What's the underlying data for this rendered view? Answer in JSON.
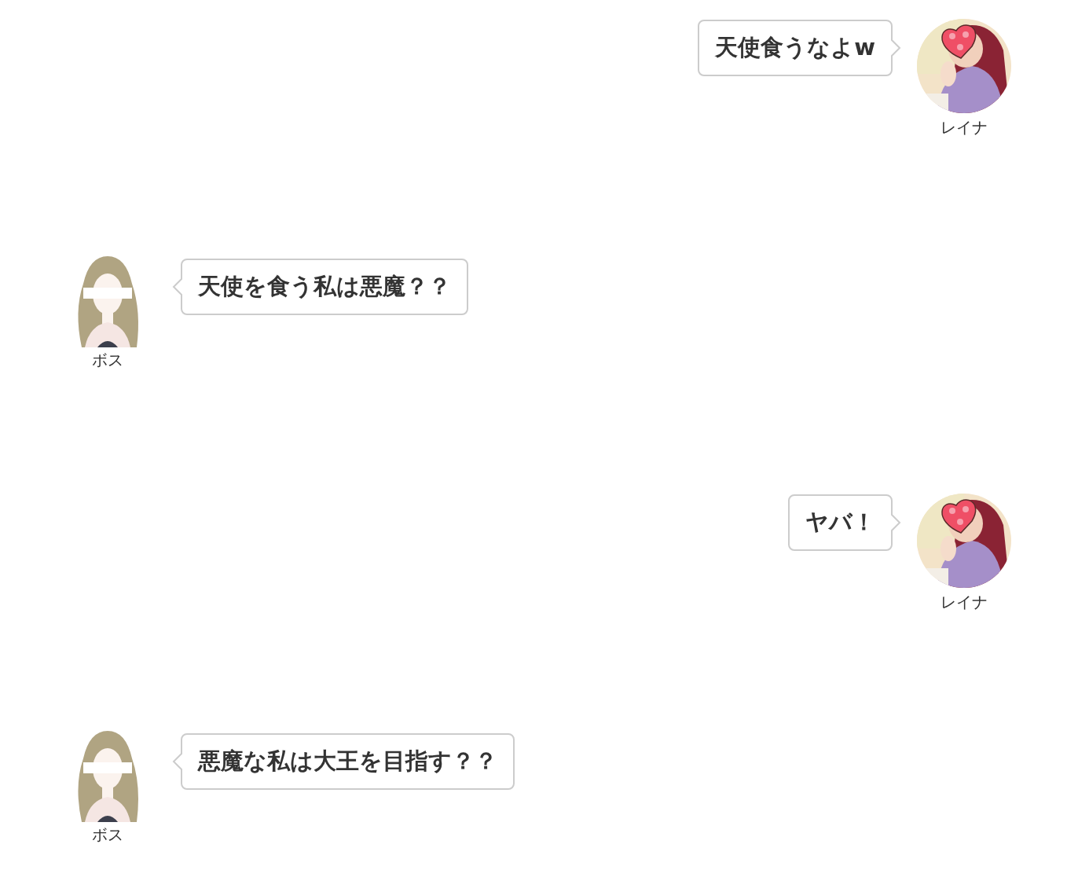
{
  "messages": [
    {
      "kind": "outgoing",
      "text": "天使食うなよw",
      "sender": "レイナ"
    },
    {
      "kind": "incoming",
      "text": "天使を食う私は悪魔？？",
      "sender": "ボス"
    },
    {
      "kind": "outgoing",
      "text": "ヤバ！",
      "sender": "レイナ"
    },
    {
      "kind": "incoming",
      "text": "悪魔な私は大王を目指す？？",
      "sender": "ボス"
    }
  ]
}
